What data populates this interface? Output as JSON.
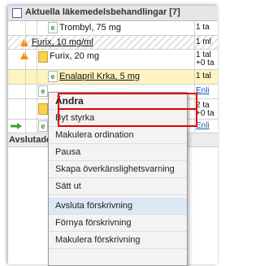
{
  "header": {
    "title": "Aktuella läkemedelsbehandlingar [7]"
  },
  "rows": [
    {
      "name": "Trombyl, 75 mg",
      "right": "1 ta"
    },
    {
      "name": "Furix, 10 mg/ml",
      "right": "1 ml"
    },
    {
      "name": "Furix, 20 mg",
      "right1": "1 tal",
      "right2": "+0 ta"
    },
    {
      "name": "Enalapril Krka, 5 mg",
      "right": "1 tal"
    },
    {
      "right": "Enli"
    },
    {
      "right1": "2 ta",
      "right2": "+0 ta"
    },
    {
      "right": "Enli"
    }
  ],
  "section": {
    "label": "Avslutade"
  },
  "menu": {
    "items": [
      "Ändra",
      "Byt styrka",
      "Makulera ordination",
      "Pausa",
      "Skapa överkänslighetsvarning",
      "Sätt ut",
      "Avsluta förskrivning",
      "Förnya förskrivning",
      "Makulera förskrivning"
    ]
  },
  "icons": {
    "doc_letter": "e",
    "warning_symbol": "!"
  },
  "colors": {
    "highlight_border": "#e00000",
    "selected_row": "#fff3bf",
    "menu_hover": "#dde8f6",
    "link": "#1a56b0"
  }
}
